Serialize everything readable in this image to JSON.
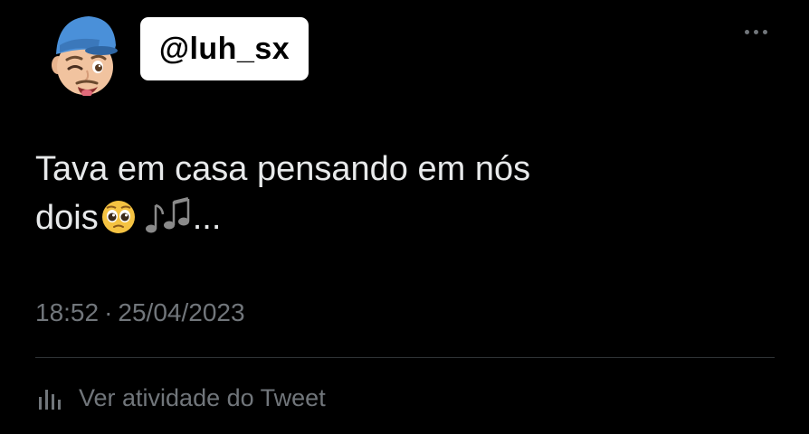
{
  "tweet": {
    "handle": "@luh_sx",
    "text_line1": "Tava em casa pensando em nós",
    "text_line2_word": "dois",
    "text_line2_suffix": "...",
    "emojis": [
      "pleading-face-emoji",
      "musical-notes-emoji"
    ],
    "time": "18:52",
    "separator": "·",
    "date": "25/04/2023",
    "activity_label": "Ver atividade do Tweet"
  },
  "icons": {
    "more": "more-dots-icon",
    "activity": "bar-chart-icon",
    "avatar": "memoji-avatar"
  },
  "colors": {
    "background": "#000000",
    "text": "#e7e9ea",
    "secondary": "#71767b",
    "divider": "#2f3336",
    "handle_box": "#ffffff",
    "cap": "#4a90d9"
  }
}
